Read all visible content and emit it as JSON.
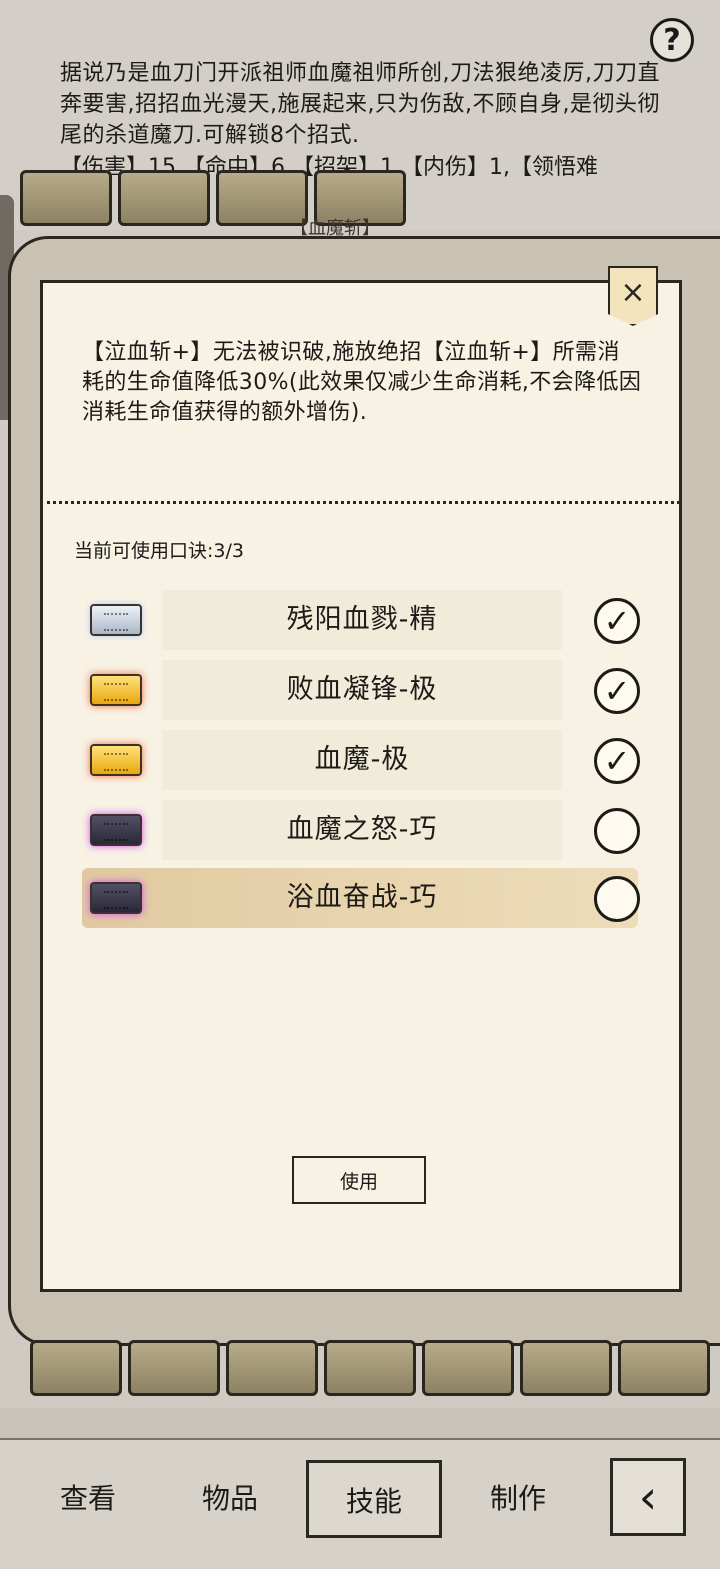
{
  "header": {
    "help_label": "?",
    "description": "据说乃是血刀门开派祖师血魔祖师所创,刀法狠绝凌厉,刀刀直奔要害,招招血光漫天,施展起来,只为伤敌,不顾自身,是彻头彻尾的杀道魔刀.可解锁8个招式.",
    "stats": "【伤害】15,【命中】6,【招架】1,【内伤】1,【领悟难",
    "partial_tab": "【血魔斩】"
  },
  "modal": {
    "close_label": "×",
    "effect_text": "【泣血斩+】无法被识破,施放绝招【泣血斩+】所需消耗的生命值降低30%(此效果仅减少生命消耗,不会降低因消耗生命值获得的额外增伤).",
    "uses_label": "当前可使用口诀:3/3",
    "skills": [
      {
        "name": "残阳血戮-精",
        "checked": "✓",
        "grade": "silver"
      },
      {
        "name": "败血凝锋-极",
        "checked": "✓",
        "grade": "gold"
      },
      {
        "name": "血魔-极",
        "checked": "✓",
        "grade": "gold"
      },
      {
        "name": "血魔之怒-巧",
        "checked": "",
        "grade": "dark"
      },
      {
        "name": "浴血奋战-巧",
        "checked": "",
        "grade": "dark"
      }
    ],
    "use_button": "使用"
  },
  "nav": {
    "items": [
      "查看",
      "物品",
      "技能",
      "制作"
    ],
    "active": "技能",
    "back_icon": "back-arrow-icon"
  }
}
